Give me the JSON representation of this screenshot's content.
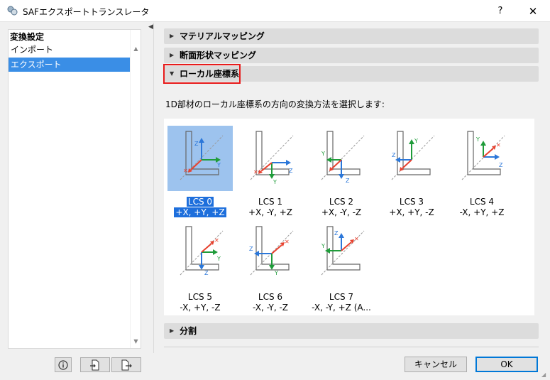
{
  "window": {
    "title": "SAFエクスポートトランスレータ",
    "help_label": "?",
    "close_label": "✕"
  },
  "sidebar": {
    "header": "変換設定",
    "items": [
      {
        "label": "インポート",
        "selected": false
      },
      {
        "label": "エクスポート",
        "selected": true
      }
    ]
  },
  "sections": {
    "material": "マテリアルマッピング",
    "profile": "断面形状マッピング",
    "local_cs": "ローカル座標系",
    "split": "分割"
  },
  "description": "1D部材のローカル座標系の方向の変換方法を選択します:",
  "lcs_options": [
    {
      "name": "LCS 0",
      "axes": "+X, +Y, +Z",
      "selected": true
    },
    {
      "name": "LCS 1",
      "axes": "+X, -Y, +Z",
      "selected": false
    },
    {
      "name": "LCS 2",
      "axes": "+X, -Y, -Z",
      "selected": false
    },
    {
      "name": "LCS 3",
      "axes": "+X, +Y, -Z",
      "selected": false
    },
    {
      "name": "LCS 4",
      "axes": "-X, +Y, +Z",
      "selected": false
    },
    {
      "name": "LCS 5",
      "axes": "-X, +Y, -Z",
      "selected": false
    },
    {
      "name": "LCS 6",
      "axes": "-X, -Y, -Z",
      "selected": false
    },
    {
      "name": "LCS 7",
      "axes": "-X, -Y, +Z (A...",
      "selected": false
    }
  ],
  "buttons": {
    "cancel": "キャンセル",
    "ok": "OK"
  },
  "colors": {
    "accent": "#3a8ee6",
    "highlight_border": "#e81b1b",
    "axis_x": "#e8412e",
    "axis_y": "#1f9c3a",
    "axis_z": "#2b77d9"
  },
  "icons": {
    "info": "info-icon",
    "import": "import-file-icon",
    "export": "export-file-icon"
  }
}
